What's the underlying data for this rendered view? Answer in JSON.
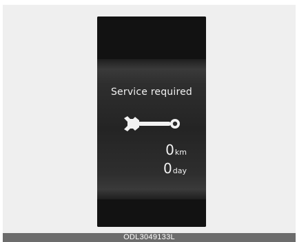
{
  "display": {
    "message": "Service required",
    "icon": "wrench-icon",
    "distance": {
      "value": "0",
      "unit": "km"
    },
    "time": {
      "value": "0",
      "unit": "day"
    }
  },
  "caption": "ODL3049133L",
  "colors": {
    "screen": "#1a1a1a",
    "text": "#f2f2f2",
    "background": "#efefef",
    "caption_bar": "#6c6c6c"
  }
}
